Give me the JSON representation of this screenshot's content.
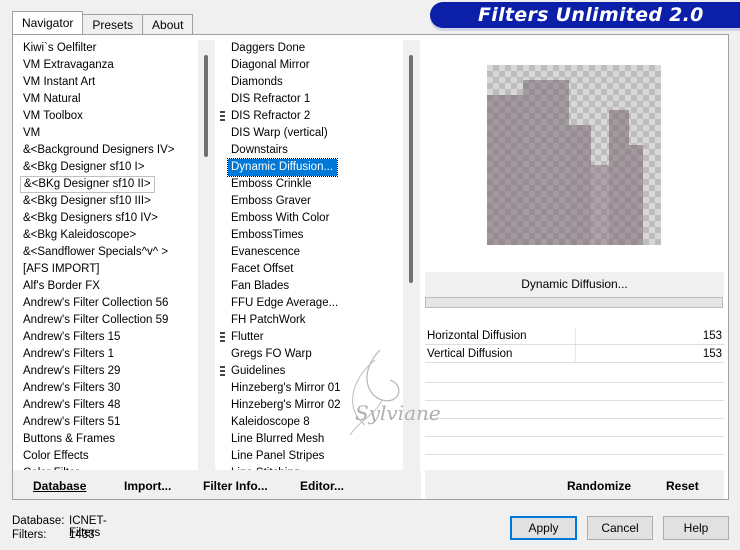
{
  "banner": {
    "title": "Filters Unlimited 2.0"
  },
  "tabs": [
    {
      "label": "Navigator"
    },
    {
      "label": "Presets"
    },
    {
      "label": "About"
    }
  ],
  "categories": [
    "Kiwi`s Oelfilter",
    "VM Extravaganza",
    "VM Instant Art",
    "VM Natural",
    "VM Toolbox",
    "VM",
    "&<Background Designers IV>",
    "&<Bkg Designer sf10 I>",
    "&<BKg Designer sf10 II>",
    "&<Bkg Designer sf10 III>",
    "&<Bkg Designers sf10 IV>",
    "&<Bkg Kaleidoscope>",
    "&<Sandflower Specials^v^ >",
    "[AFS IMPORT]",
    "Alf's Border FX",
    "Andrew's Filter Collection 56",
    "Andrew's Filter Collection 59",
    "Andrew's Filters 15",
    "Andrew's Filters 1",
    "Andrew's Filters 29",
    "Andrew's Filters 30",
    "Andrew's Filters 48",
    "Andrew's Filters 51",
    "Buttons & Frames",
    "Color Effects",
    "Color Filter"
  ],
  "filters": [
    "Daggers Done",
    "Diagonal Mirror",
    "Diamonds",
    "DIS Refractor 1",
    "DIS Refractor 2",
    "DIS Warp (vertical)",
    "Downstairs",
    "Dynamic Diffusion...",
    "Emboss Crinkle",
    "Emboss Graver",
    "Emboss With Color",
    "EmbossTimes",
    "Evanescence",
    "Facet Offset",
    "Fan Blades",
    "FFU Edge Average...",
    "FH PatchWork",
    "Flutter",
    "Gregs FO Warp",
    "Guidelines",
    "Hinzeberg's Mirror 01",
    "Hinzeberg's Mirror 02",
    "Kaleidoscope 8",
    "Line Blurred Mesh",
    "Line Panel Stripes",
    "Line Stitching"
  ],
  "left_buttons": {
    "database": "Database",
    "import": "Import...",
    "filter_info": "Filter Info...",
    "editor": "Editor..."
  },
  "preview": {
    "filter_name": "Dynamic Diffusion..."
  },
  "params": [
    {
      "label": "Horizontal Diffusion",
      "value": "153"
    },
    {
      "label": "Vertical Diffusion",
      "value": "153"
    }
  ],
  "right_buttons": {
    "randomize": "Randomize",
    "reset": "Reset"
  },
  "status": {
    "database_label": "Database:",
    "database_value": "ICNET-Filters",
    "filters_label": "Filters:",
    "filters_value": "1433"
  },
  "dialog_buttons": {
    "apply": "Apply",
    "cancel": "Cancel",
    "help": "Help"
  },
  "watermark": {
    "text": "Sylviane"
  },
  "colors": {
    "banner": "#0b1fa8",
    "selection": "#0078d7",
    "default_border": "#0078d7"
  },
  "icons": {
    "marker": "group-marker-icon"
  }
}
